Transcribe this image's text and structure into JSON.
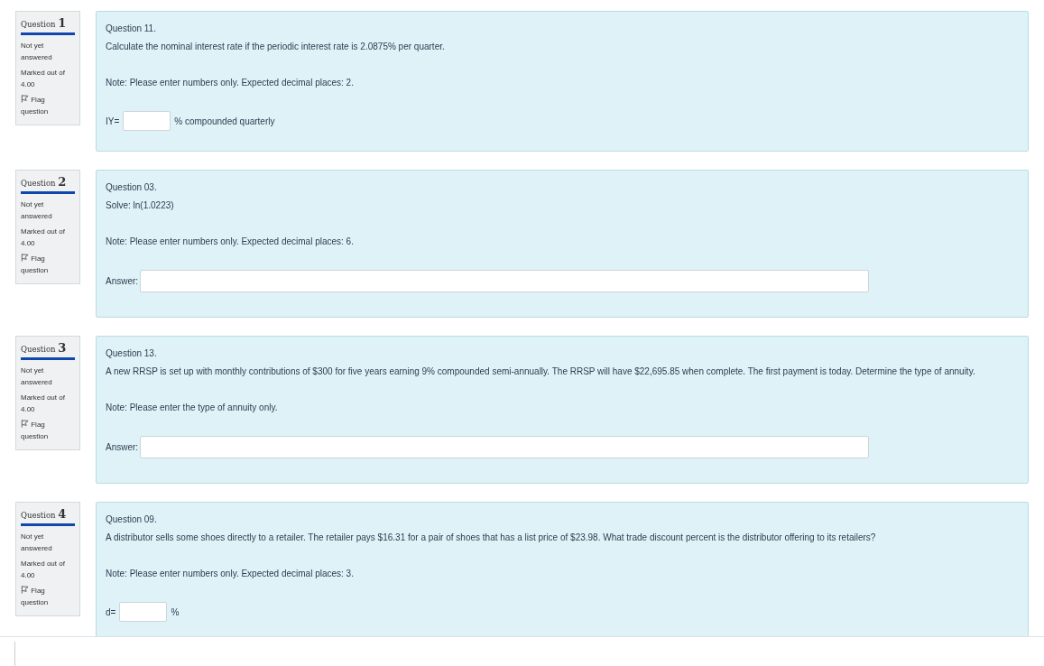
{
  "questions": [
    {
      "heading_label": "Question",
      "number": "1",
      "status": "Not yet answered",
      "marks": "Marked out of 4.00",
      "flag": "Flag question",
      "title": "Question 11.",
      "text": "Calculate the nominal interest rate if the periodic interest rate is 2.0875% per quarter.",
      "note": "Note: Please enter numbers only. Expected decimal places: 2.",
      "answer": {
        "kind": "inline",
        "prefix": "IY=",
        "suffix": "% compounded quarterly"
      }
    },
    {
      "heading_label": "Question",
      "number": "2",
      "status": "Not yet answered",
      "marks": "Marked out of 4.00",
      "flag": "Flag question",
      "title": "Question 03.",
      "text": "Solve: ln(1.0223)",
      "note": "Note: Please enter numbers only. Expected decimal places: 6.",
      "answer": {
        "kind": "wide",
        "prefix": "Answer:"
      }
    },
    {
      "heading_label": "Question",
      "number": "3",
      "status": "Not yet answered",
      "marks": "Marked out of 4.00",
      "flag": "Flag question",
      "title": "Question 13.",
      "text": "A new RRSP is set up with monthly contributions of $300 for five years earning 9% compounded semi-annually. The RRSP will have $22,695.85 when complete. The first payment is today. Determine the type of annuity.",
      "note": "Note: Please enter the type of annuity only.",
      "answer": {
        "kind": "wide",
        "prefix": "Answer:"
      }
    },
    {
      "heading_label": "Question",
      "number": "4",
      "status": "Not yet answered",
      "marks": "Marked out of 4.00",
      "flag": "Flag question",
      "title": "Question 09.",
      "text": "A distributor sells some shoes directly to a retailer. The retailer pays $16.31 for a pair of shoes that has a list price of $23.98. What trade discount percent is the distributor offering to its retailers?",
      "note": "Note: Please enter numbers only. Expected decimal places: 3.",
      "answer": {
        "kind": "inline",
        "prefix": "d=",
        "suffix": "%"
      }
    }
  ]
}
